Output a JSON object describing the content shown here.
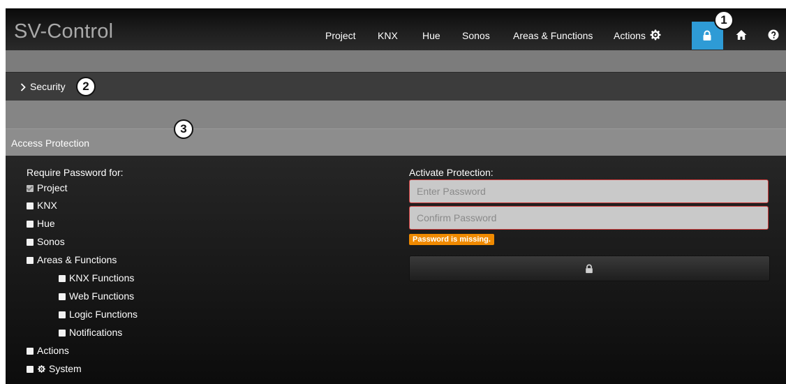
{
  "app": {
    "brand": "SV-Control"
  },
  "nav": {
    "items": [
      "Project",
      "KNX",
      "Hue",
      "Sonos",
      "Areas & Functions",
      "Actions"
    ],
    "icons": [
      "gear-icon",
      "lock-icon",
      "home-icon",
      "help-icon"
    ],
    "active": "lock-icon"
  },
  "security": {
    "label": "Security"
  },
  "access": {
    "title": "Access Protection",
    "require_label": "Require Password for:",
    "options": [
      {
        "label": "Project",
        "checked": true
      },
      {
        "label": "KNX",
        "checked": false
      },
      {
        "label": "Hue",
        "checked": false
      },
      {
        "label": "Sonos",
        "checked": false
      },
      {
        "label": "Areas & Functions",
        "checked": false
      },
      {
        "label": "KNX Functions",
        "checked": false
      },
      {
        "label": "Web Functions",
        "checked": false
      },
      {
        "label": "Logic Functions",
        "checked": false
      },
      {
        "label": "Notifications",
        "checked": false
      },
      {
        "label": "Actions",
        "checked": false
      },
      {
        "label": "System",
        "checked": false
      }
    ],
    "activate_label": "Activate Protection:",
    "password_placeholder": "Enter Password",
    "confirm_placeholder": "Confirm Password",
    "error_text": "Password is missing.",
    "password_value": "",
    "confirm_value": ""
  },
  "callouts": [
    "1",
    "2",
    "3"
  ],
  "colors": {
    "accent": "#2e9bd6",
    "error": "#d03a3a",
    "warning": "#f08a00"
  }
}
